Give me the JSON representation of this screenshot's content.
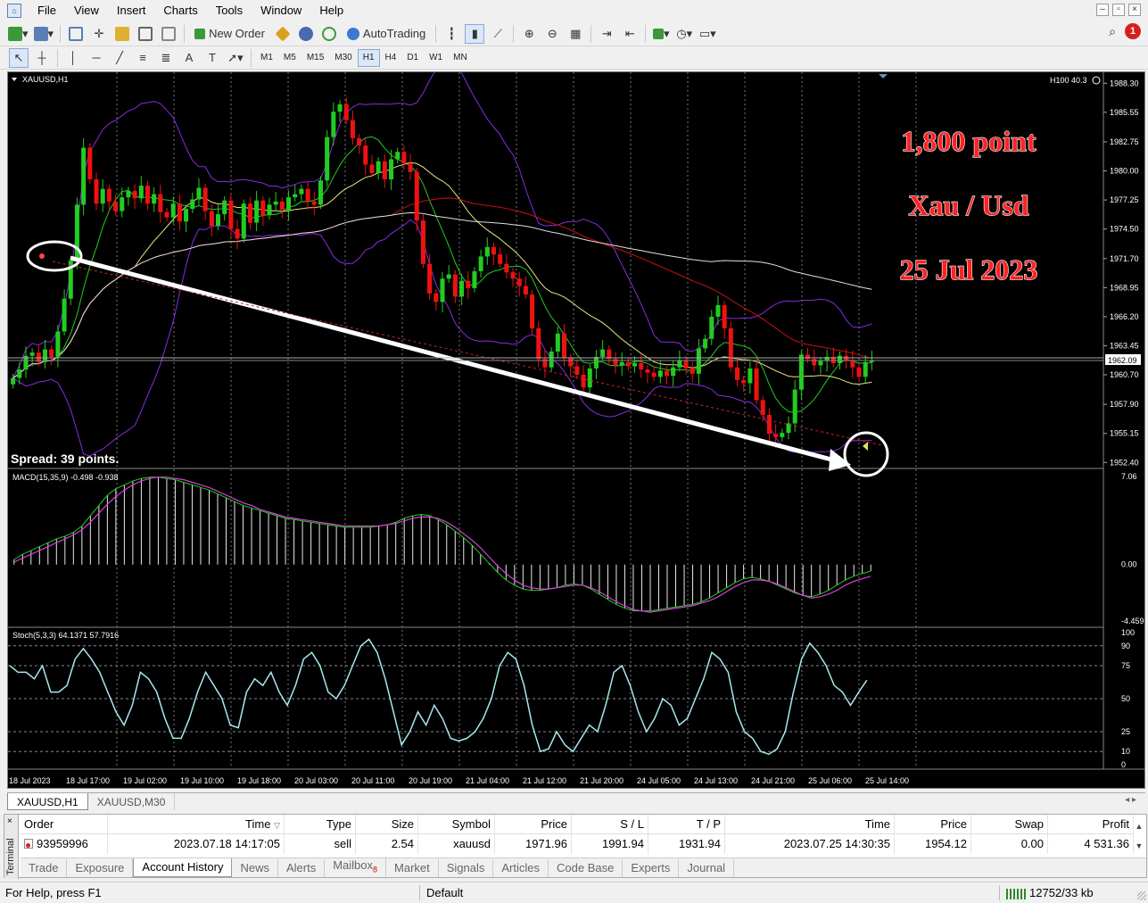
{
  "menu": {
    "items": [
      "File",
      "View",
      "Insert",
      "Charts",
      "Tools",
      "Window",
      "Help"
    ]
  },
  "toolbar": {
    "new_order_label": "New Order",
    "autotrading_label": "AutoTrading",
    "notification_count": "1"
  },
  "timeframes": [
    "M1",
    "M5",
    "M15",
    "M30",
    "H1",
    "H4",
    "D1",
    "W1",
    "MN"
  ],
  "active_timeframe": "H1",
  "chart": {
    "symbol_label": "XAUUSD,H1",
    "top_right_label": "H100 40.3",
    "current_price_label": "1962.09",
    "spread_label": "Spread: 39 points.",
    "annotation_lines": [
      "1,800 point",
      "Xau / Usd",
      "25 Jul 2023"
    ],
    "macd_label": "MACD(15,35,9) -0.498 -0.938",
    "stoch_label": "Stoch(5,3,3) 64.1371 57.7916",
    "colors": {
      "background": "#000000",
      "bull": "#22cc22",
      "bear": "#ee1111",
      "annotation_text": "#ff2222",
      "bollinger": "#8a2be2",
      "ma_slow": "#cc1111",
      "ma_fast": "#e6e680",
      "ma_long": "#e0e0e0",
      "macd_signal": "#d63fd6",
      "stoch": "#a8e8f0"
    }
  },
  "chart_data": {
    "type": "candlestick",
    "price_axis_ticks": [
      "1988.30",
      "1985.55",
      "1982.75",
      "1980.00",
      "1977.25",
      "1974.50",
      "1971.70",
      "1968.95",
      "1966.20",
      "1963.45",
      "1960.70",
      "1957.90",
      "1955.15",
      "1952.40"
    ],
    "price_range": [
      1952.0,
      1989.0
    ],
    "time_axis_ticks": [
      "18 Jul 2023",
      "18 Jul 17:00",
      "19 Jul 02:00",
      "19 Jul 10:00",
      "19 Jul 18:00",
      "20 Jul 03:00",
      "20 Jul 11:00",
      "20 Jul 19:00",
      "21 Jul 04:00",
      "21 Jul 12:00",
      "21 Jul 20:00",
      "24 Jul 05:00",
      "24 Jul 13:00",
      "24 Jul 21:00",
      "25 Jul 06:00",
      "25 Jul 14:00"
    ],
    "close_series": [
      1960.4,
      1961.2,
      1962.5,
      1962.8,
      1961.9,
      1963.1,
      1962.4,
      1964.8,
      1967.9,
      1971.5,
      1976.8,
      1982.2,
      1979.2,
      1976.9,
      1978.3,
      1977.1,
      1976.2,
      1977.5,
      1978.1,
      1977.4,
      1978.6,
      1976.9,
      1977.8,
      1976.1,
      1975.6,
      1976.9,
      1975.2,
      1976.4,
      1977.3,
      1978.4,
      1976.2,
      1974.8,
      1975.9,
      1977.2,
      1974.5,
      1973.6,
      1976.9,
      1975.1,
      1977.2,
      1975.8,
      1976.8,
      1977.1,
      1976.3,
      1977.5,
      1977.8,
      1978.3,
      1977.1,
      1976.8,
      1979.1,
      1983.2,
      1985.6,
      1986.3,
      1984.8,
      1983.1,
      1982.4,
      1980.6,
      1979.8,
      1980.9,
      1979.2,
      1981.1,
      1981.8,
      1980.7,
      1979.9,
      1975.3,
      1971.2,
      1968.4,
      1967.6,
      1969.8,
      1970.2,
      1968.1,
      1969.6,
      1968.9,
      1970.5,
      1971.9,
      1972.8,
      1972.1,
      1971.2,
      1970.4,
      1969.8,
      1969.1,
      1968.3,
      1965.1,
      1962.2,
      1961.4,
      1962.9,
      1964.6,
      1962.3,
      1961.5,
      1960.7,
      1959.5,
      1961.3,
      1962.4,
      1963.1,
      1962.2,
      1961.6,
      1961.9,
      1961.5,
      1961.8,
      1961.2,
      1960.9,
      1960.5,
      1961.1,
      1960.6,
      1961.4,
      1962.1,
      1961.3,
      1960.8,
      1963.2,
      1964.1,
      1966.2,
      1967.3,
      1965.1,
      1961.4,
      1960.2,
      1959.9,
      1961.3,
      1958.3,
      1956.9,
      1955.1,
      1954.8,
      1955.2,
      1956.1,
      1959.3,
      1962.6,
      1962.2,
      1961.6,
      1962.0,
      1962.4,
      1961.8,
      1962.5,
      1962.1,
      1961.4,
      1960.5,
      1961.9,
      1962.09
    ],
    "indicators": [
      "Bollinger Bands",
      "Moving Average (fast)",
      "Moving Average (slow)",
      "Moving Average (long)",
      "MACD(15,35,9)",
      "Stoch(5,3,3)"
    ],
    "macd_axis_ticks": [
      "7.06",
      "0.00",
      "-4.459"
    ],
    "macd_range": [
      -4.459,
      7.06
    ],
    "macd_histogram": [
      0.4,
      0.8,
      1.1,
      1.4,
      1.7,
      2.0,
      2.2,
      2.5,
      3.0,
      3.8,
      4.6,
      5.4,
      5.9,
      6.2,
      6.5,
      6.7,
      6.8,
      6.8,
      6.7,
      6.6,
      6.4,
      6.2,
      6.0,
      5.8,
      5.5,
      5.2,
      4.9,
      4.6,
      4.4,
      4.2,
      4.0,
      3.8,
      3.6,
      3.5,
      3.4,
      3.3,
      3.2,
      3.1,
      3.0,
      2.9,
      2.9,
      2.9,
      2.9,
      3.0,
      3.1,
      3.3,
      3.6,
      3.8,
      3.9,
      3.8,
      3.5,
      3.1,
      2.6,
      2.1,
      1.5,
      0.8,
      0.1,
      -0.6,
      -1.2,
      -1.6,
      -1.9,
      -2.0,
      -2.0,
      -1.9,
      -1.8,
      -1.6,
      -1.5,
      -1.6,
      -1.9,
      -2.3,
      -2.7,
      -3.1,
      -3.4,
      -3.6,
      -3.6,
      -3.6,
      -3.5,
      -3.4,
      -3.3,
      -3.2,
      -3.1,
      -2.9,
      -2.6,
      -2.2,
      -1.8,
      -1.4,
      -1.1,
      -1.0,
      -1.1,
      -1.3,
      -1.6,
      -1.9,
      -2.2,
      -2.4,
      -2.5,
      -2.3,
      -2.0,
      -1.6,
      -1.2,
      -0.9,
      -0.7,
      -0.5
    ],
    "macd_signal": [
      0.2,
      0.5,
      0.8,
      1.1,
      1.4,
      1.7,
      2.0,
      2.3,
      2.7,
      3.3,
      4.0,
      4.7,
      5.3,
      5.8,
      6.2,
      6.5,
      6.7,
      6.8,
      6.8,
      6.7,
      6.6,
      6.4,
      6.2,
      6.0,
      5.7,
      5.4,
      5.1,
      4.8,
      4.6,
      4.3,
      4.1,
      3.9,
      3.7,
      3.6,
      3.5,
      3.4,
      3.3,
      3.2,
      3.1,
      3.0,
      3.0,
      3.0,
      3.0,
      3.0,
      3.1,
      3.2,
      3.4,
      3.6,
      3.7,
      3.7,
      3.6,
      3.3,
      2.9,
      2.4,
      1.9,
      1.3,
      0.6,
      -0.1,
      -0.7,
      -1.2,
      -1.6,
      -1.8,
      -1.9,
      -1.9,
      -1.8,
      -1.7,
      -1.6,
      -1.6,
      -1.8,
      -2.1,
      -2.5,
      -2.9,
      -3.2,
      -3.5,
      -3.6,
      -3.7,
      -3.6,
      -3.5,
      -3.4,
      -3.3,
      -3.2,
      -3.0,
      -2.8,
      -2.5,
      -2.1,
      -1.7,
      -1.4,
      -1.2,
      -1.2,
      -1.3,
      -1.5,
      -1.8,
      -2.1,
      -2.4,
      -2.6,
      -2.5,
      -2.3,
      -2.0,
      -1.6,
      -1.3,
      -1.1,
      -0.9
    ],
    "stoch_axis_ticks": [
      "100",
      "90",
      "75",
      "50",
      "25",
      "10",
      "0"
    ],
    "stoch_range": [
      0,
      100
    ],
    "stoch_levels": [
      10,
      25,
      50,
      75,
      90
    ],
    "stoch_values": [
      75,
      70,
      70,
      65,
      75,
      55,
      55,
      60,
      80,
      88,
      80,
      70,
      55,
      40,
      30,
      45,
      70,
      65,
      55,
      35,
      20,
      20,
      35,
      55,
      70,
      60,
      50,
      30,
      28,
      55,
      65,
      60,
      70,
      55,
      45,
      60,
      80,
      85,
      75,
      55,
      50,
      60,
      75,
      90,
      95,
      85,
      65,
      40,
      15,
      25,
      40,
      30,
      45,
      35,
      20,
      18,
      20,
      25,
      35,
      50,
      75,
      85,
      80,
      60,
      30,
      10,
      12,
      25,
      15,
      10,
      20,
      30,
      25,
      45,
      70,
      75,
      60,
      40,
      25,
      35,
      50,
      45,
      30,
      35,
      50,
      65,
      85,
      80,
      70,
      40,
      25,
      20,
      10,
      8,
      12,
      25,
      55,
      80,
      92,
      85,
      75,
      60,
      55,
      45,
      55,
      64
    ]
  },
  "chart_tabs": [
    "XAUUSD,H1",
    "XAUUSD,M30"
  ],
  "terminal": {
    "side_label": "Terminal",
    "columns": [
      "Order",
      "Time",
      "Type",
      "Size",
      "Symbol",
      "Price",
      "S / L",
      "T / P",
      "Time",
      "Price",
      "Swap",
      "Profit"
    ],
    "rows": [
      [
        "93959996",
        "2023.07.18 14:17:05",
        "sell",
        "2.54",
        "xauusd",
        "1971.96",
        "1991.94",
        "1931.94",
        "2023.07.25 14:30:35",
        "1954.12",
        "0.00",
        "4 531.36"
      ]
    ],
    "tabs": [
      "Trade",
      "Exposure",
      "Account History",
      "News",
      "Alerts",
      "Mailbox",
      "Market",
      "Signals",
      "Articles",
      "Code Base",
      "Experts",
      "Journal"
    ],
    "mailbox_count": "8",
    "active_tab": "Account History"
  },
  "status": {
    "help_text": "For Help, press F1",
    "profile": "Default",
    "traffic": "12752/33 kb"
  }
}
